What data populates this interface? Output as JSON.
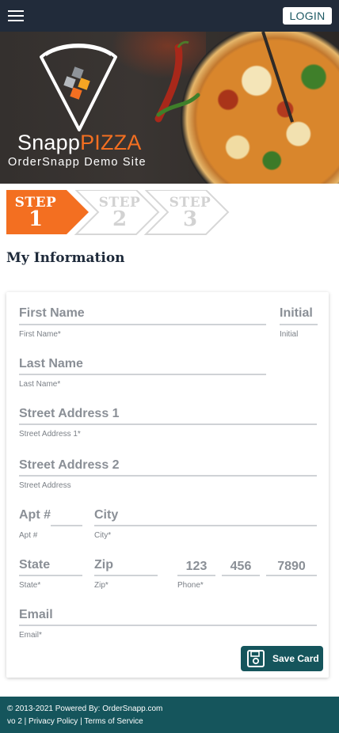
{
  "header": {
    "menu_icon": "hamburger-menu-icon",
    "login_label": "LOGIN"
  },
  "hero": {
    "brand_part1": "Snapp",
    "brand_part2": "PIZZA",
    "subtitle": "OrderSnapp Demo Site",
    "accent_color": "#f36f21"
  },
  "steps": [
    {
      "label": "STEP",
      "number": "1",
      "state": "active",
      "color": "#f36f21"
    },
    {
      "label": "STEP",
      "number": "2",
      "state": "inactive",
      "color": "#d7d7d7"
    },
    {
      "label": "STEP",
      "number": "3",
      "state": "inactive",
      "color": "#d7d7d7"
    }
  ],
  "section_title": "My Information",
  "form": {
    "first_name": {
      "placeholder": "First Name",
      "label": "First Name*"
    },
    "initial": {
      "placeholder": "Initial",
      "label": "Initial"
    },
    "last_name": {
      "placeholder": "Last Name",
      "label": "Last Name*"
    },
    "street1": {
      "placeholder": "Street Address 1",
      "label": "Street Address 1*"
    },
    "street2": {
      "placeholder": "Street Address 2",
      "label": "Street Address"
    },
    "apt": {
      "placeholder": "Apt #",
      "label": "Apt #"
    },
    "city": {
      "placeholder": "City",
      "label": "City*"
    },
    "state": {
      "placeholder": "State",
      "label": "State*"
    },
    "zip": {
      "placeholder": "Zip",
      "label": "Zip*"
    },
    "phone": {
      "part1": "123",
      "part2": "456",
      "part3": "7890",
      "label": "Phone*"
    },
    "email": {
      "placeholder": "Email",
      "label": "Email*"
    },
    "save_label": "Save Card",
    "save_icon": "floppy-disk-icon"
  },
  "footer": {
    "line1": "© 2013-2021 Powered By: OrderSnapp.com",
    "line2": "vo 2 | Privacy Policy | Terms of Service"
  },
  "colors": {
    "nav_bg": "#212b3a",
    "teal": "#15555c",
    "orange": "#f36f21"
  }
}
